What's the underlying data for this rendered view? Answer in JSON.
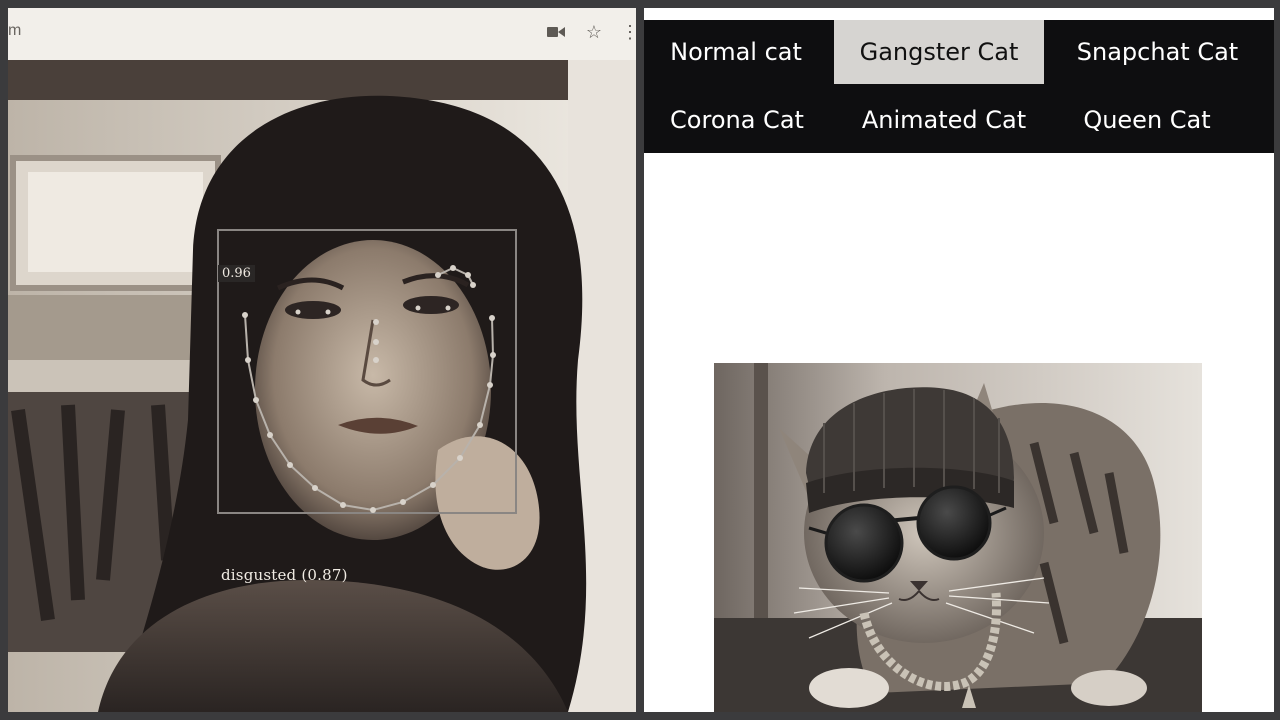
{
  "browser": {
    "url_fragment": "m",
    "icons": {
      "video": "video-camera-icon",
      "star": "bookmark-star-icon",
      "menu": "more-menu-icon"
    }
  },
  "detection": {
    "score": "0.96",
    "expression": "disgusted (0.87)"
  },
  "cat_app": {
    "buttons": [
      {
        "label": "Normal cat",
        "active": false
      },
      {
        "label": "Gangster Cat",
        "active": true
      },
      {
        "label": "Snapchat Cat",
        "active": false
      },
      {
        "label": "Corona Cat",
        "active": false
      },
      {
        "label": "Animated Cat",
        "active": false
      },
      {
        "label": "Queen Cat",
        "active": false
      }
    ],
    "colors": {
      "button_bg": "#0e0e10",
      "active_bg": "#d6d4d1",
      "text": "#ffffff"
    }
  }
}
